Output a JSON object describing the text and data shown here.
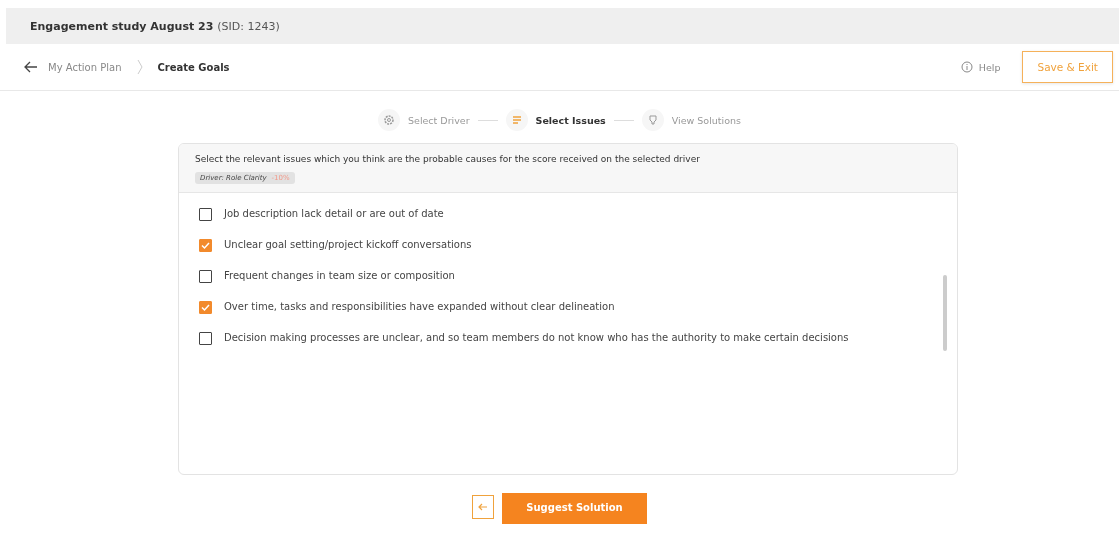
{
  "header": {
    "study": "Engagement study August 23",
    "sid": "(SID: 1243)"
  },
  "breadcrumb": {
    "parent": "My Action Plan",
    "current": "Create Goals"
  },
  "help": "Help",
  "save_button": "Save & Exit",
  "steps": [
    {
      "label": "Select Driver",
      "kind": "gear",
      "selected": false
    },
    {
      "label": "Select Issues",
      "kind": "list",
      "selected": true
    },
    {
      "label": "View Solutions",
      "kind": "bulb",
      "selected": false
    }
  ],
  "instruction": "Select the relevant issues which you think are the probable causes for the score received on the selected driver",
  "driver_tag": {
    "label": "Driver: Role Clarity",
    "score": "-10%"
  },
  "issues": [
    {
      "label": "Job description lack detail or are out of date",
      "checked": false
    },
    {
      "label": "Unclear goal setting/project kickoff conversations",
      "checked": true
    },
    {
      "label": "Frequent changes in team size or composition",
      "checked": false
    },
    {
      "label": "Over time, tasks and responsibilities have expanded without clear delineation",
      "checked": true
    },
    {
      "label": "Decision making processes are unclear, and so team members do not know who has the authority to make certain decisions",
      "checked": false
    }
  ],
  "primary_button": "Suggest Solution"
}
